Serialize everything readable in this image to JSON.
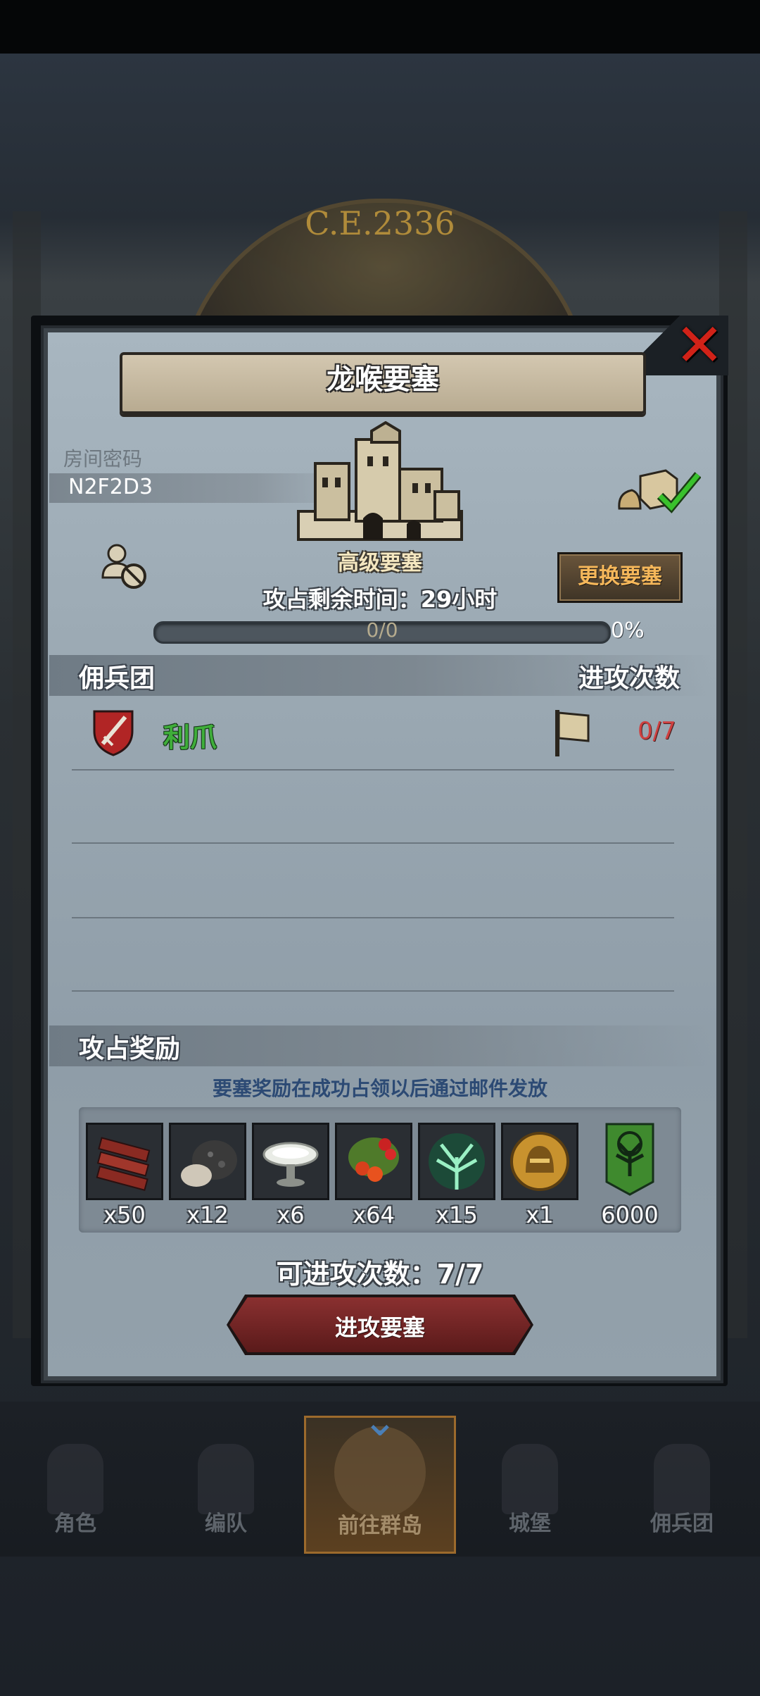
{
  "background": {
    "year": "C.E.2336"
  },
  "dialog": {
    "title": "龙喉要塞",
    "close_icon": "close-icon",
    "room_code_label": "房间密码",
    "room_code": "N2F2D3",
    "fortress_grade": "高级要塞",
    "change_fortress_label": "更换要塞",
    "countdown": "攻占剩余时间：29小时",
    "progress": {
      "text": "0/0",
      "percent": "0%",
      "fraction": 0
    },
    "mercenary_header": "佣兵团",
    "attack_count_header": "进攻次数",
    "guilds": [
      {
        "name": "利爪",
        "attacks": "0/7",
        "emblem": "red-shield-sword-icon"
      }
    ],
    "reward_header": "攻占奖励",
    "reward_note": "要塞奖励在成功占领以后通过邮件发放",
    "rewards": [
      {
        "icon": "wood-planks-icon",
        "qty": "x50"
      },
      {
        "icon": "ore-rock-icon",
        "qty": "x12"
      },
      {
        "icon": "salt-bowl-icon",
        "qty": "x6"
      },
      {
        "icon": "berries-icon",
        "qty": "x64"
      },
      {
        "icon": "green-crystal-tree-icon",
        "qty": "x15"
      },
      {
        "icon": "golden-helmet-medal-icon",
        "qty": "x1"
      },
      {
        "icon": "green-tree-banner-icon",
        "qty": "6000"
      }
    ],
    "attempts": "可进攻次数：7/7",
    "attack_button_label": "进攻要塞"
  },
  "bottom_nav": [
    {
      "label": "角色",
      "active": false
    },
    {
      "label": "编队",
      "active": false
    },
    {
      "label": "前往群岛",
      "active": true
    },
    {
      "label": "城堡",
      "active": false
    },
    {
      "label": "佣兵团",
      "active": false
    }
  ],
  "colors": {
    "panel": "#9aa8b2",
    "accent_red": "#d12218",
    "guild_green": "#3fae3a",
    "attack_red": "#cf4040",
    "note_blue": "#2c4a74"
  }
}
